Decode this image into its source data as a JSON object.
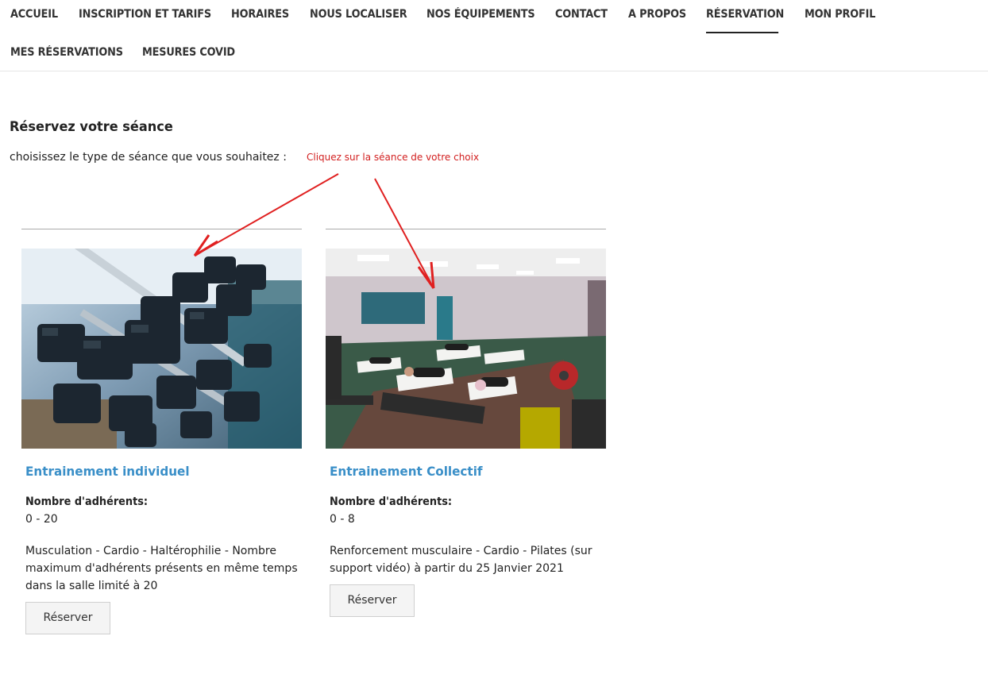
{
  "nav": {
    "items": [
      {
        "label": "ACCUEIL"
      },
      {
        "label": "INSCRIPTION ET TARIFS"
      },
      {
        "label": "HORAIRES"
      },
      {
        "label": "NOUS LOCALISER"
      },
      {
        "label": "NOS ÉQUIPEMENTS"
      },
      {
        "label": "CONTACT"
      },
      {
        "label": "A PROPOS"
      },
      {
        "label": "RÉSERVATION"
      },
      {
        "label": "MON PROFIL"
      },
      {
        "label": "MES RÉSERVATIONS"
      },
      {
        "label": "MESURES COVID"
      }
    ],
    "active": "RÉSERVATION"
  },
  "page": {
    "title": "Réservez votre séance",
    "subtitle": "choisissez le type de séance que vous souhaitez :",
    "annotation": "Cliquez sur la séance de votre choix"
  },
  "cards": [
    {
      "title": "Entrainement individuel",
      "members_label": "Nombre d'adhérents:",
      "members_range": "0 - 20",
      "description": "Musculation - Cardio - Haltérophilie - Nombre maximum d'adhérents présents en même temps dans la salle limité à 20",
      "button": "Réserver",
      "image": "dumbbell-rack-photo"
    },
    {
      "title": "Entrainement Collectif",
      "members_label": "Nombre d'adhérents:",
      "members_range": "0 - 8",
      "description": "Renforcement musculaire - Cardio - Pilates (sur support vidéo) à partir du 25 Janvier 2021",
      "button": "Réserver",
      "image": "group-class-gym-photo"
    }
  ],
  "colors": {
    "accent": "#3a8fc8",
    "annotation": "#d22020",
    "nav_text": "#333333"
  }
}
